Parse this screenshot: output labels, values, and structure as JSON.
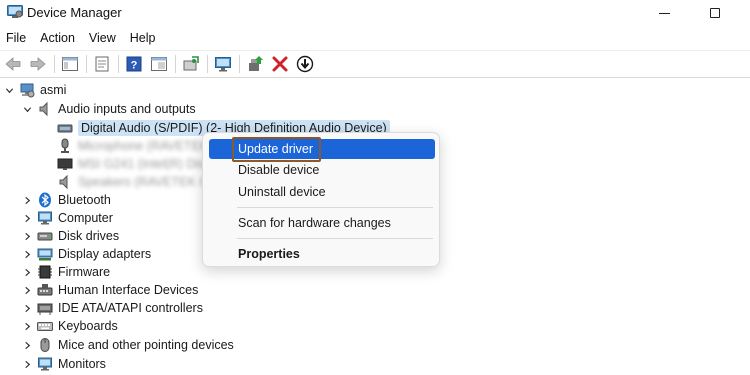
{
  "window": {
    "title": "Device Manager",
    "icon": "device-manager-icon"
  },
  "menu": [
    "File",
    "Action",
    "View",
    "Help"
  ],
  "toolbar": {
    "icons": [
      "back-arrow-icon",
      "forward-arrow-icon",
      "show-hide-console-tree-icon",
      "properties-icon",
      "help-icon",
      "export-list-icon",
      "scan-hardware-icon",
      "monitor-icon",
      "update-driver-icon",
      "uninstall-x-icon",
      "disable-down-arrow-icon"
    ]
  },
  "tree": {
    "root": "asmi",
    "expanded_category": "Audio inputs and outputs",
    "audio_children": {
      "selected": "Digital Audio (S/PDIF) (2- High Definition Audio Device)",
      "blurred": [
        "Microphone (RAVETEK)",
        "MSI G241 (Intel(R) Display Audio)",
        "Speakers (RAVETEK CA)"
      ]
    },
    "categories": [
      "Bluetooth",
      "Computer",
      "Disk drives",
      "Display adapters",
      "Firmware",
      "Human Interface Devices",
      "IDE ATA/ATAPI controllers",
      "Keyboards",
      "Mice and other pointing devices",
      "Monitors"
    ]
  },
  "context_menu": {
    "items": [
      "Update driver",
      "Disable device",
      "Uninstall device",
      "Scan for hardware changes",
      "Properties"
    ],
    "highlighted": "Update driver",
    "highlight_color": "#1b65d8",
    "annotation_color": "#8a5a2a"
  }
}
